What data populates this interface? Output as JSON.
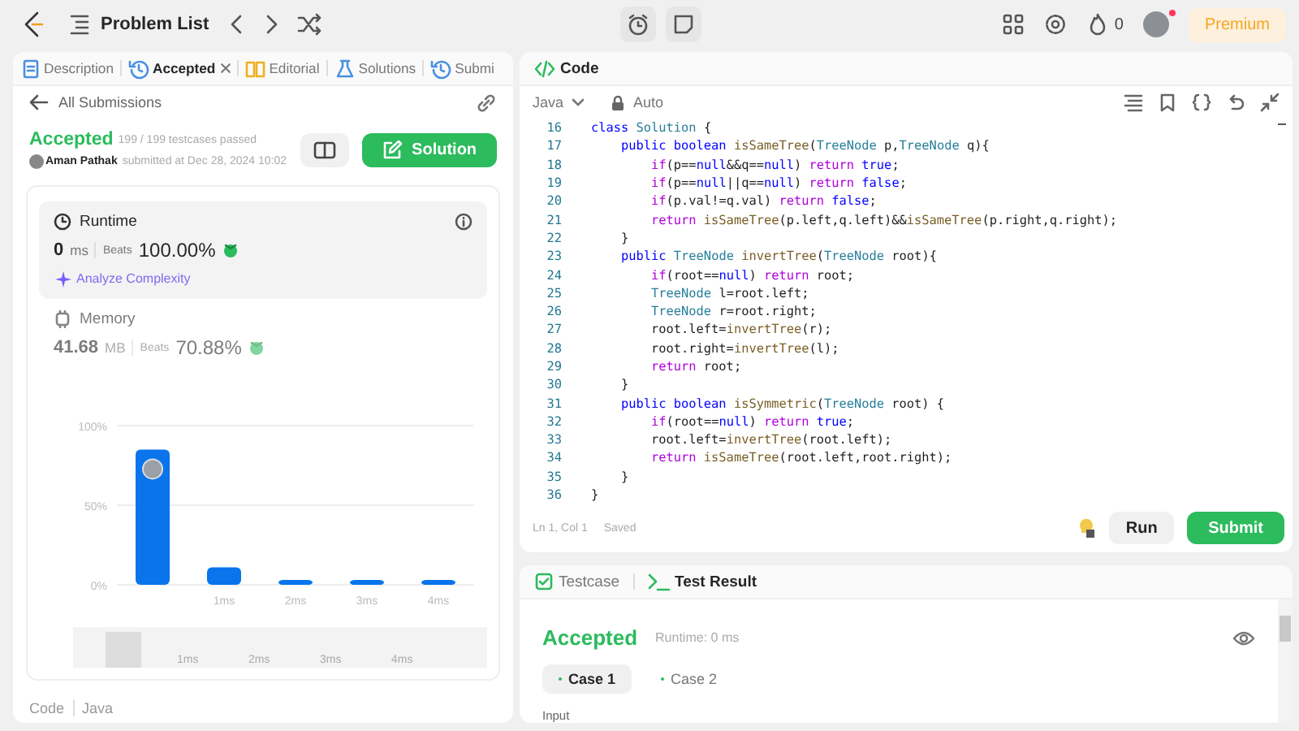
{
  "topbar": {
    "title": "Problem List",
    "streak": "0",
    "premium": "Premium",
    "notification_dot": true
  },
  "left_panel": {
    "tabs": [
      {
        "label": "Description",
        "selected": false,
        "closable": false
      },
      {
        "label": "Accepted",
        "selected": true,
        "closable": true
      },
      {
        "label": "Editorial",
        "selected": false,
        "closable": false
      },
      {
        "label": "Solutions",
        "selected": false,
        "closable": false
      },
      {
        "label": "Submi",
        "selected": false,
        "closable": false
      }
    ],
    "back_link": "All Submissions",
    "submission": {
      "status": "Accepted",
      "testcases": "199 / 199 testcases passed",
      "author": "Aman Pathak",
      "submitted": "submitted at Dec 28, 2024 10:02",
      "solution_button": "Solution"
    },
    "metrics": [
      {
        "title": "Runtime",
        "value": "0",
        "unit": "ms",
        "beats_label": "Beats",
        "beats": "100.00%",
        "selected": true,
        "action": "Analyze Complexity"
      },
      {
        "title": "Memory",
        "value": "41.68",
        "unit": "MB",
        "beats_label": "Beats",
        "beats": "70.88%",
        "selected": false
      }
    ],
    "chart_data": {
      "type": "bar",
      "categories": [
        null,
        "1ms",
        "2ms",
        "3ms",
        "4ms"
      ],
      "values": [
        85,
        11,
        3,
        3,
        3
      ],
      "ylim": [
        0,
        100
      ],
      "yticks": [
        {
          "value": 0,
          "label": "0%"
        },
        {
          "value": 50,
          "label": "50%"
        },
        {
          "value": 100,
          "label": "100%"
        }
      ]
    },
    "navigator_labels": [
      "1ms",
      "2ms",
      "3ms",
      "4ms"
    ],
    "footer": {
      "section": "Code",
      "language": "Java"
    }
  },
  "code_panel": {
    "title": "Code",
    "language": "Java",
    "mode": "Auto",
    "lines": [
      {
        "n": "16",
        "seg": [
          {
            "kind": "kw",
            "text": "class "
          },
          {
            "kind": "type",
            "text": "Solution"
          },
          {
            "kind": "p",
            "text": " {"
          }
        ]
      },
      {
        "n": "17",
        "seg": [
          {
            "kind": "kw",
            "text": "    public boolean "
          },
          {
            "kind": "fn",
            "text": "isSameTree"
          },
          {
            "kind": "p",
            "text": "("
          },
          {
            "kind": "type",
            "text": "TreeNode"
          },
          {
            "kind": "p",
            "text": " p,"
          },
          {
            "kind": "type",
            "text": "TreeNode"
          },
          {
            "kind": "p",
            "text": " q){"
          }
        ]
      },
      {
        "n": "18",
        "seg": [
          {
            "kind": "ctl",
            "text": "        if"
          },
          {
            "kind": "p",
            "text": "(p=="
          },
          {
            "kind": "kw",
            "text": "null"
          },
          {
            "kind": "p",
            "text": "&&q=="
          },
          {
            "kind": "kw",
            "text": "null"
          },
          {
            "kind": "p",
            "text": ") "
          },
          {
            "kind": "ctl",
            "text": "return"
          },
          {
            "kind": "kw",
            "text": " true"
          },
          {
            "kind": "p",
            "text": ";"
          }
        ]
      },
      {
        "n": "19",
        "seg": [
          {
            "kind": "ctl",
            "text": "        if"
          },
          {
            "kind": "p",
            "text": "(p=="
          },
          {
            "kind": "kw",
            "text": "null"
          },
          {
            "kind": "p",
            "text": "||q=="
          },
          {
            "kind": "kw",
            "text": "null"
          },
          {
            "kind": "p",
            "text": ") "
          },
          {
            "kind": "ctl",
            "text": "return"
          },
          {
            "kind": "kw",
            "text": " false"
          },
          {
            "kind": "p",
            "text": ";"
          }
        ]
      },
      {
        "n": "20",
        "seg": [
          {
            "kind": "ctl",
            "text": "        if"
          },
          {
            "kind": "p",
            "text": "(p.val!=q.val) "
          },
          {
            "kind": "ctl",
            "text": "return"
          },
          {
            "kind": "kw",
            "text": " false"
          },
          {
            "kind": "p",
            "text": ";"
          }
        ]
      },
      {
        "n": "21",
        "seg": [
          {
            "kind": "ctl",
            "text": "        return"
          },
          {
            "kind": "fn",
            "text": " isSameTree"
          },
          {
            "kind": "p",
            "text": "(p.left,q.left)&&"
          },
          {
            "kind": "fn",
            "text": "isSameTree"
          },
          {
            "kind": "p",
            "text": "(p.right,q.right);"
          }
        ]
      },
      {
        "n": "22",
        "seg": [
          {
            "kind": "p",
            "text": "    }"
          }
        ]
      },
      {
        "n": "23",
        "seg": [
          {
            "kind": "kw",
            "text": "    public "
          },
          {
            "kind": "type",
            "text": "TreeNode"
          },
          {
            "kind": "fn",
            "text": " invertTree"
          },
          {
            "kind": "p",
            "text": "("
          },
          {
            "kind": "type",
            "text": "TreeNode"
          },
          {
            "kind": "p",
            "text": " root){"
          }
        ]
      },
      {
        "n": "24",
        "seg": [
          {
            "kind": "ctl",
            "text": "        if"
          },
          {
            "kind": "p",
            "text": "(root=="
          },
          {
            "kind": "kw",
            "text": "null"
          },
          {
            "kind": "p",
            "text": ") "
          },
          {
            "kind": "ctl",
            "text": "return"
          },
          {
            "kind": "p",
            "text": " root;"
          }
        ]
      },
      {
        "n": "25",
        "seg": [
          {
            "kind": "type",
            "text": "        TreeNode"
          },
          {
            "kind": "p",
            "text": " l=root.left;"
          }
        ]
      },
      {
        "n": "26",
        "seg": [
          {
            "kind": "type",
            "text": "        TreeNode"
          },
          {
            "kind": "p",
            "text": " r=root.right;"
          }
        ]
      },
      {
        "n": "27",
        "seg": [
          {
            "kind": "p",
            "text": "        root.left="
          },
          {
            "kind": "fn",
            "text": "invertTree"
          },
          {
            "kind": "p",
            "text": "(r);"
          }
        ]
      },
      {
        "n": "28",
        "seg": [
          {
            "kind": "p",
            "text": "        root.right="
          },
          {
            "kind": "fn",
            "text": "invertTree"
          },
          {
            "kind": "p",
            "text": "(l);"
          }
        ]
      },
      {
        "n": "29",
        "seg": [
          {
            "kind": "ctl",
            "text": "        return"
          },
          {
            "kind": "p",
            "text": " root;"
          }
        ]
      },
      {
        "n": "30",
        "seg": [
          {
            "kind": "p",
            "text": "    }"
          }
        ]
      },
      {
        "n": "31",
        "seg": [
          {
            "kind": "kw",
            "text": "    public boolean "
          },
          {
            "kind": "fn",
            "text": "isSymmetric"
          },
          {
            "kind": "p",
            "text": "("
          },
          {
            "kind": "type",
            "text": "TreeNode"
          },
          {
            "kind": "p",
            "text": " root) {"
          }
        ]
      },
      {
        "n": "32",
        "seg": [
          {
            "kind": "ctl",
            "text": "        if"
          },
          {
            "kind": "p",
            "text": "(root=="
          },
          {
            "kind": "kw",
            "text": "null"
          },
          {
            "kind": "p",
            "text": ") "
          },
          {
            "kind": "ctl",
            "text": "return"
          },
          {
            "kind": "kw",
            "text": " true"
          },
          {
            "kind": "p",
            "text": ";"
          }
        ]
      },
      {
        "n": "33",
        "seg": [
          {
            "kind": "p",
            "text": "        root.left="
          },
          {
            "kind": "fn",
            "text": "invertTree"
          },
          {
            "kind": "p",
            "text": "(root.left);"
          }
        ]
      },
      {
        "n": "34",
        "seg": [
          {
            "kind": "ctl",
            "text": "        return"
          },
          {
            "kind": "fn",
            "text": " isSameTree"
          },
          {
            "kind": "p",
            "text": "(root.left,root.right);"
          }
        ]
      },
      {
        "n": "35",
        "seg": [
          {
            "kind": "p",
            "text": "    }"
          }
        ]
      },
      {
        "n": "36",
        "seg": [
          {
            "kind": "p",
            "text": "}"
          }
        ]
      }
    ],
    "cursor": "Ln 1, Col 1",
    "save_state": "Saved",
    "run": "Run",
    "submit": "Submit"
  },
  "test_panel": {
    "tabs": [
      {
        "label": "Testcase",
        "selected": false
      },
      {
        "label": "Test Result",
        "selected": true
      }
    ],
    "status": "Accepted",
    "runtime": "Runtime: 0 ms",
    "cases": [
      {
        "label": "Case 1",
        "selected": true
      },
      {
        "label": "Case 2",
        "selected": false
      }
    ],
    "input_label": "Input"
  }
}
